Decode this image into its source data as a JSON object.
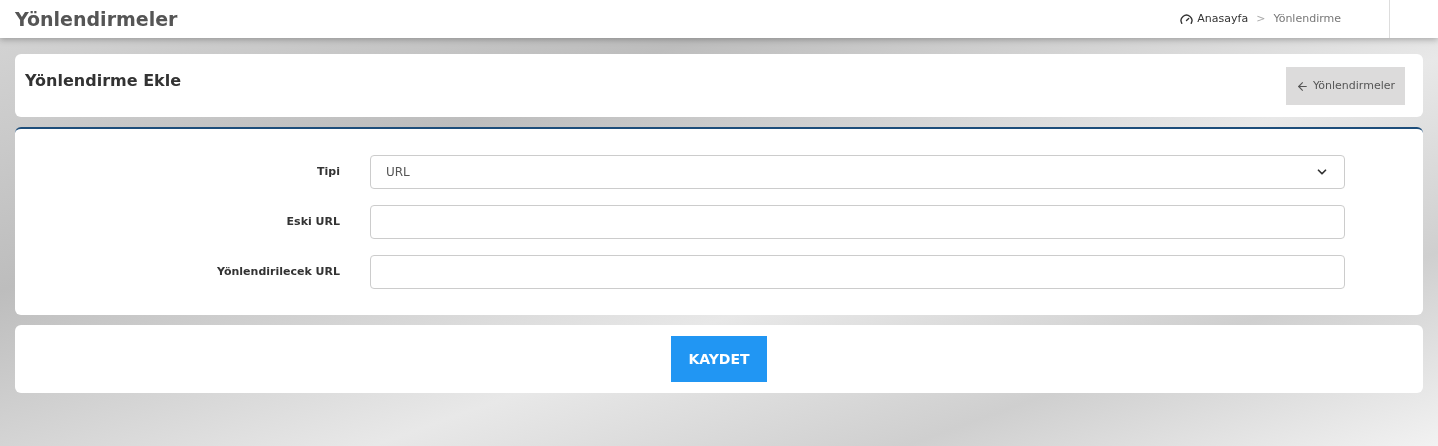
{
  "header": {
    "title": "Yönlendirmeler",
    "breadcrumb": [
      {
        "label": "Anasayfa",
        "kind": "home"
      },
      {
        "label": ">",
        "kind": "separator"
      },
      {
        "label": "Yönlendirme",
        "kind": "current"
      }
    ]
  },
  "card": {
    "title": "Yönlendirme Ekle",
    "back_button": "Yönlendirmeler"
  },
  "form": [
    {
      "label": "Tipi",
      "kind": "select",
      "value": "URL"
    },
    {
      "label": "Eski URL",
      "kind": "input"
    },
    {
      "label": "Yönlendirilecek URL",
      "kind": "input"
    }
  ],
  "submit": "KAYDET"
}
